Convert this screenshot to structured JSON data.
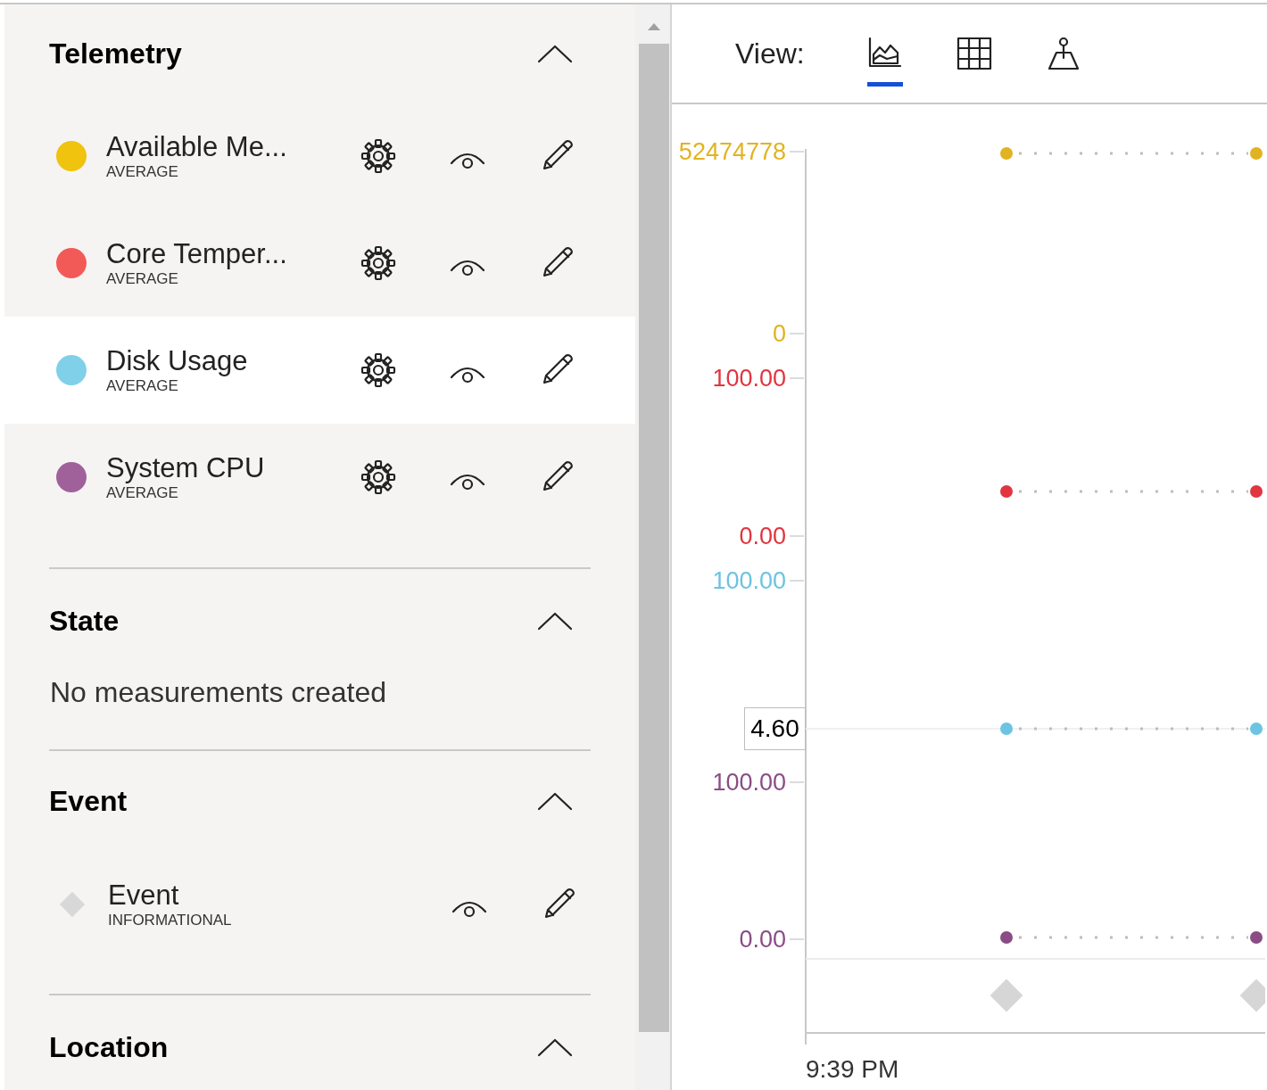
{
  "sections": [
    {
      "title": "Telemetry",
      "expanded": true,
      "items": [
        {
          "kind": "telemetry",
          "name": "Available Me...",
          "aggregation": "AVERAGE",
          "color": "#efc30e",
          "selected": false
        },
        {
          "kind": "telemetry",
          "name": "Core Temper...",
          "aggregation": "AVERAGE",
          "color": "#f25a58",
          "selected": false
        },
        {
          "kind": "telemetry",
          "name": "Disk Usage",
          "aggregation": "AVERAGE",
          "color": "#80d0ea",
          "selected": true
        },
        {
          "kind": "telemetry",
          "name": "System CPU",
          "aggregation": "AVERAGE",
          "color": "#a0619b",
          "selected": false
        }
      ]
    },
    {
      "title": "State",
      "expanded": true,
      "empty_text": "No measurements created"
    },
    {
      "title": "Event",
      "expanded": true,
      "items": [
        {
          "kind": "event",
          "name": "Event",
          "aggregation": "INFORMATIONAL",
          "selected": false
        }
      ]
    },
    {
      "title": "Location",
      "expanded": true
    }
  ],
  "view": {
    "label": "View:",
    "options": [
      {
        "kind": "chart",
        "selected": true
      },
      {
        "kind": "table",
        "selected": false
      },
      {
        "kind": "map",
        "selected": false
      }
    ]
  },
  "chart": {
    "lanes": [
      {
        "color": "#e2b320",
        "ticks": [
          "52474778",
          "0"
        ]
      },
      {
        "color": "#e1353f",
        "ticks": [
          "100.00",
          "0.00"
        ]
      },
      {
        "color": "#6cc3e2",
        "ticks": [
          "100.00"
        ]
      },
      {
        "color": "#8b4c86",
        "ticks": [
          "100.00",
          "0.00"
        ]
      }
    ],
    "tooltip": "4.60",
    "x_label": "9:39 PM"
  }
}
